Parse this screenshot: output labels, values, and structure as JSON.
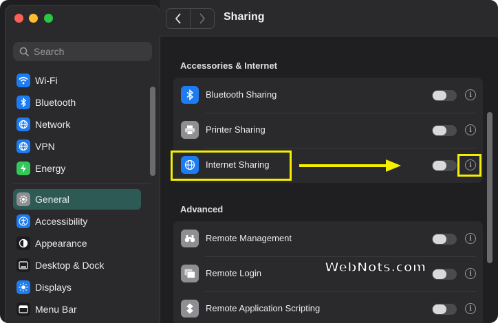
{
  "window": {
    "title": "Sharing"
  },
  "search": {
    "placeholder": "Search"
  },
  "sidebar": {
    "items": [
      {
        "label": "Wi-Fi",
        "icon": "wifi-icon",
        "color": "#1e7cf2"
      },
      {
        "label": "Bluetooth",
        "icon": "bluetooth-icon",
        "color": "#1e7cf2"
      },
      {
        "label": "Network",
        "icon": "globe-icon",
        "color": "#1e7cf2"
      },
      {
        "label": "VPN",
        "icon": "vpn-globe-icon",
        "color": "#1e7cf2"
      },
      {
        "label": "Energy",
        "icon": "bolt-icon",
        "color": "#34c759"
      },
      {
        "label": "General",
        "icon": "gear-icon",
        "color": "#8e8e93",
        "active": true
      },
      {
        "label": "Accessibility",
        "icon": "accessibility-icon",
        "color": "#1e7cf2"
      },
      {
        "label": "Appearance",
        "icon": "appearance-icon",
        "color": "#1c1c1e"
      },
      {
        "label": "Desktop & Dock",
        "icon": "dock-icon",
        "color": "#1c1c1e"
      },
      {
        "label": "Displays",
        "icon": "sun-icon",
        "color": "#1e7cf2"
      },
      {
        "label": "Menu Bar",
        "icon": "menubar-icon",
        "color": "#1c1c1e"
      }
    ]
  },
  "sections": [
    {
      "title": "Accessories & Internet",
      "rows": [
        {
          "label": "Bluetooth Sharing",
          "icon": "bluetooth-icon",
          "enabled": false
        },
        {
          "label": "Printer Sharing",
          "icon": "printer-icon",
          "enabled": false
        },
        {
          "label": "Internet Sharing",
          "icon": "globe-icon",
          "enabled": false
        }
      ]
    },
    {
      "title": "Advanced",
      "rows": [
        {
          "label": "Remote Management",
          "icon": "binoculars-icon",
          "enabled": false
        },
        {
          "label": "Remote Login",
          "icon": "terminal-icon",
          "enabled": false
        },
        {
          "label": "Remote Application Scripting",
          "icon": "script-icon",
          "enabled": false
        }
      ]
    }
  ],
  "watermark": "WebNots.com",
  "colors": {
    "highlight": "#f5f000",
    "accent": "#2e5a56"
  }
}
